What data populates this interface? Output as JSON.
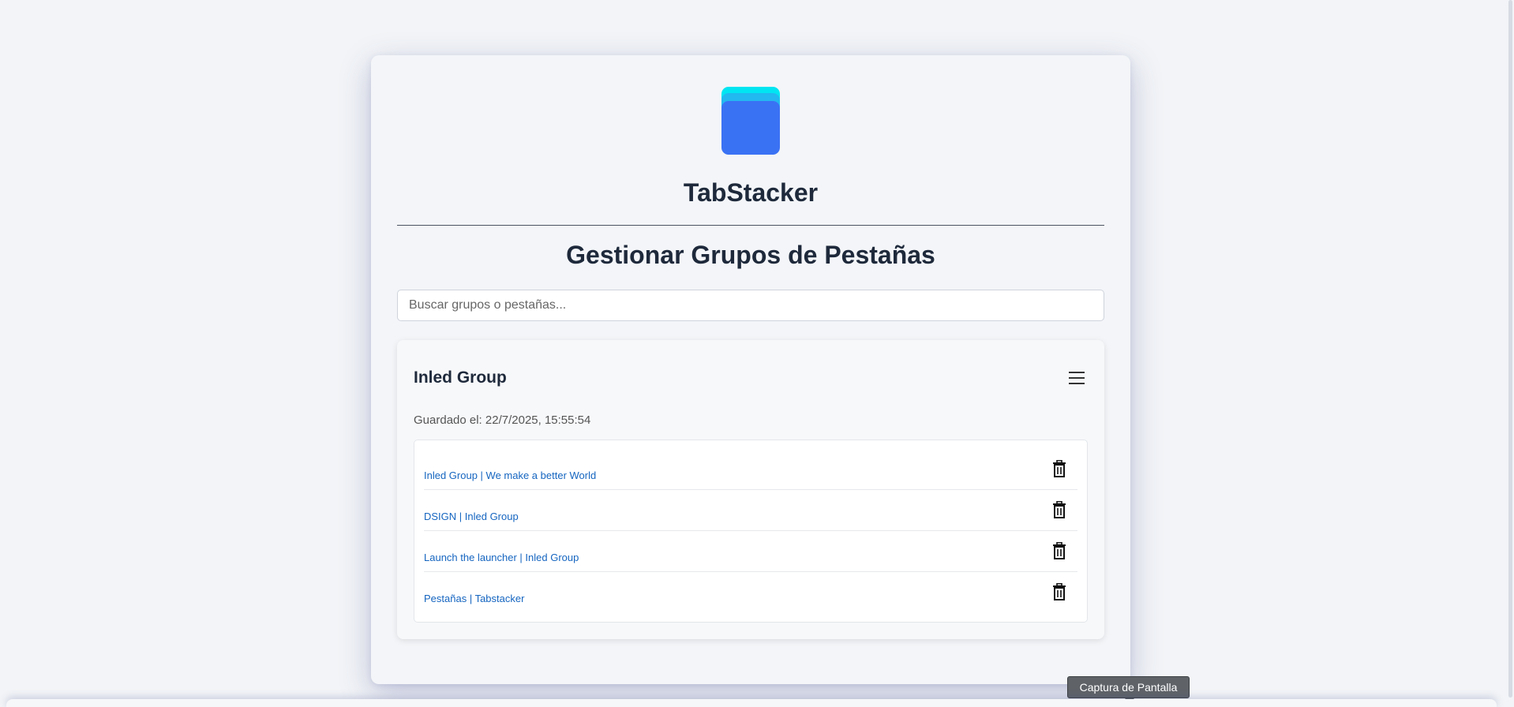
{
  "app": {
    "title": "TabStacker",
    "logo_icon": "stacked-tabs-logo",
    "colors": {
      "logo_top": "#00e5f2",
      "logo_mid": "#22b8f0",
      "logo_main": "#3a72f4",
      "link": "#1565c0"
    }
  },
  "page": {
    "title": "Gestionar Grupos de Pestañas"
  },
  "search": {
    "placeholder": "Buscar grupos o pestañas...",
    "value": ""
  },
  "group": {
    "name": "Inled Group",
    "menu_icon": "hamburger-menu-icon",
    "saved_text": "Guardado el: 22/7/2025, 15:55:54",
    "tabs": [
      {
        "title": "Inled Group | We make a better World",
        "delete_icon": "trash-icon"
      },
      {
        "title": "DSIGN | Inled Group",
        "delete_icon": "trash-icon"
      },
      {
        "title": "Launch the launcher | Inled Group",
        "delete_icon": "trash-icon"
      },
      {
        "title": "Pestañas | Tabstacker",
        "delete_icon": "trash-icon"
      }
    ]
  },
  "tooltip": {
    "text": "Captura de Pantalla"
  }
}
